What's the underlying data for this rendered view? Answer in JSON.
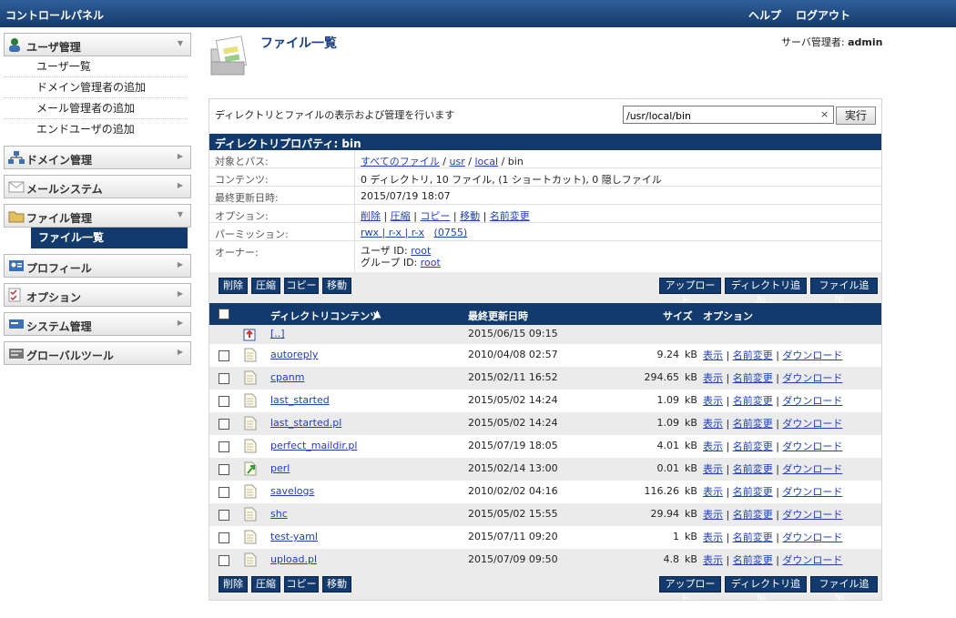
{
  "header": {
    "title": "コントロールパネル",
    "help": "ヘルプ",
    "logout": "ログアウト"
  },
  "sidebar": {
    "user": {
      "label": "ユーザ管理",
      "items": [
        "ユーザ一覧",
        "ドメイン管理者の追加",
        "メール管理者の追加",
        "エンドユーザの追加"
      ]
    },
    "domain": "ドメイン管理",
    "mail": "メールシステム",
    "file": {
      "label": "ファイル管理",
      "items": [
        "ファイル一覧"
      ]
    },
    "profile": "プロフィール",
    "options": "オプション",
    "system": "システム管理",
    "global": "グローバルツール"
  },
  "page": {
    "title": "ファイル一覧",
    "admin_label": "サーバ管理者:",
    "admin_name": "admin"
  },
  "toolbar": {
    "description": "ディレクトリとファイルの表示および管理を行います",
    "path_value": "/usr/local/bin",
    "clear": "×",
    "run": "実行"
  },
  "props": {
    "heading": "ディレクトリプロパティ: bin",
    "path_label": "対象とパス:",
    "path_all": "すべてのファイル",
    "path_sep": "/",
    "path_usr": "usr",
    "path_local": "local",
    "path_bin": "/ bin",
    "contents_label": "コンテンツ:",
    "contents_value": "0 ディレクトリ, 10 ファイル, (1 ショートカット), 0 隠しファイル",
    "modified_label": "最終更新日時:",
    "modified_value": "2015/07/19 18:07",
    "options_label": "オプション:",
    "opt_delete": "削除",
    "opt_compress": "圧縮",
    "opt_copy": "コピー",
    "opt_move": "移動",
    "opt_rename": "名前変更",
    "perm_label": "パーミッション:",
    "perm_value": "rwx | r-x | r-x",
    "perm_octal": "(0755)",
    "owner_label": "オーナー:",
    "owner_user_label": "ユーザ ID:",
    "owner_user": "root",
    "owner_group_label": "グループ ID:",
    "owner_group": "root"
  },
  "actions": {
    "delete": "削除",
    "compress": "圧縮",
    "copy": "コピー",
    "move": "移動",
    "upload": "アップロード...",
    "add_dir": "ディレクトリ追加...",
    "add_file": "ファイル追加..."
  },
  "table": {
    "col_name": "ディレクトリコンテンツ",
    "col_sort": "▲",
    "col_date": "最終更新日時",
    "col_size": "サイズ",
    "col_options": "オプション",
    "parent": {
      "name": "[..]",
      "date": "2015/06/15 09:15"
    },
    "op_view": "表示",
    "op_rename": "名前変更",
    "op_download": "ダウンロード",
    "unit": "kB",
    "rows": [
      {
        "name": "autoreply",
        "date": "2010/04/08 02:57",
        "size": "9.24",
        "icon": "file-icon"
      },
      {
        "name": "cpanm",
        "date": "2015/02/11 16:52",
        "size": "294.65",
        "icon": "file-icon"
      },
      {
        "name": "last_started",
        "date": "2015/05/02 14:24",
        "size": "1.09",
        "icon": "file-icon"
      },
      {
        "name": "last_started.pl",
        "date": "2015/05/02 14:24",
        "size": "1.09",
        "icon": "file-icon"
      },
      {
        "name": "perfect_maildir.pl",
        "date": "2015/07/19 18:05",
        "size": "4.01",
        "icon": "file-icon"
      },
      {
        "name": "perl",
        "date": "2015/02/14 13:00",
        "size": "0.01",
        "icon": "shortcut-icon"
      },
      {
        "name": "savelogs",
        "date": "2010/02/02 04:16",
        "size": "116.26",
        "icon": "file-icon"
      },
      {
        "name": "shc",
        "date": "2015/05/02 15:55",
        "size": "29.94",
        "icon": "file-icon"
      },
      {
        "name": "test-yaml",
        "date": "2015/07/11 09:20",
        "size": "1",
        "icon": "file-icon"
      },
      {
        "name": "upload.pl",
        "date": "2015/07/09 09:50",
        "size": "4.8",
        "icon": "file-icon"
      }
    ]
  }
}
